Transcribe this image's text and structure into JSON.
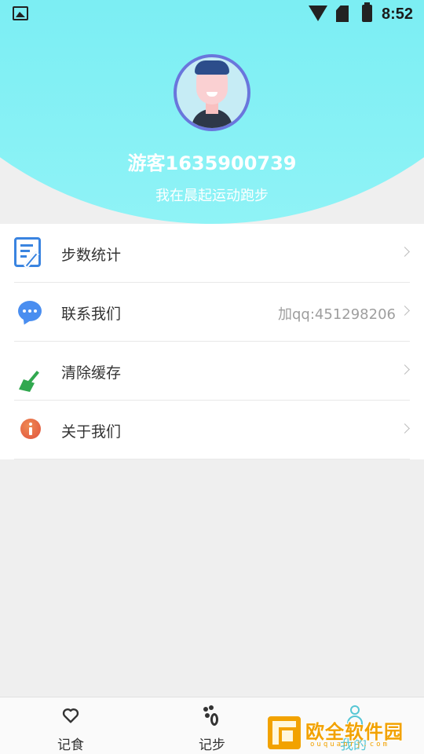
{
  "status_bar": {
    "time": "8:52"
  },
  "profile": {
    "username": "游客1635900739",
    "slogan": "我在晨起运动跑步"
  },
  "menu": {
    "items": [
      {
        "label": "步数统计",
        "extra": ""
      },
      {
        "label": "联系我们",
        "extra": "加qq:451298206"
      },
      {
        "label": "清除缓存",
        "extra": ""
      },
      {
        "label": "关于我们",
        "extra": ""
      }
    ]
  },
  "bottom_nav": {
    "tabs": [
      {
        "label": "记食"
      },
      {
        "label": "记步"
      },
      {
        "label": "我的"
      }
    ]
  },
  "watermark": {
    "text": "欧全软件园",
    "url": "ouquanrj.com"
  },
  "colors": {
    "header": "#7feff4",
    "accent": "#55c6d4",
    "page_bg": "#efefef"
  }
}
